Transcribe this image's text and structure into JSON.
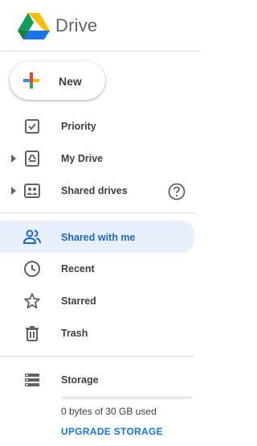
{
  "header": {
    "app_name": "Drive",
    "logo_icon": "google-drive-logo"
  },
  "new_button": {
    "label": "New",
    "icon": "plus-multicolor-icon"
  },
  "nav": {
    "priority": {
      "label": "Priority",
      "icon": "checkbox-icon"
    },
    "my_drive": {
      "label": "My Drive",
      "icon": "drive-folder-icon",
      "expandable": true
    },
    "shared_drives": {
      "label": "Shared drives",
      "icon": "shared-drive-icon",
      "expandable": true,
      "help_icon": "help-circle-icon"
    },
    "shared_with_me": {
      "label": "Shared with me",
      "icon": "people-icon",
      "selected": true
    },
    "recent": {
      "label": "Recent",
      "icon": "clock-icon"
    },
    "starred": {
      "label": "Starred",
      "icon": "star-icon"
    },
    "trash": {
      "label": "Trash",
      "icon": "trash-icon"
    }
  },
  "storage": {
    "label": "Storage",
    "icon": "storage-icon",
    "used_text": "0 bytes of 30 GB used",
    "used_fraction": 0,
    "upgrade_label": "UPGRADE STORAGE"
  },
  "colors": {
    "accent": "#1a73e8",
    "selected_bg": "#e8f0fe",
    "selected_text": "#1967d2",
    "icon_gray": "#5f6368",
    "text": "#3c4043",
    "divider": "#dadce0"
  }
}
